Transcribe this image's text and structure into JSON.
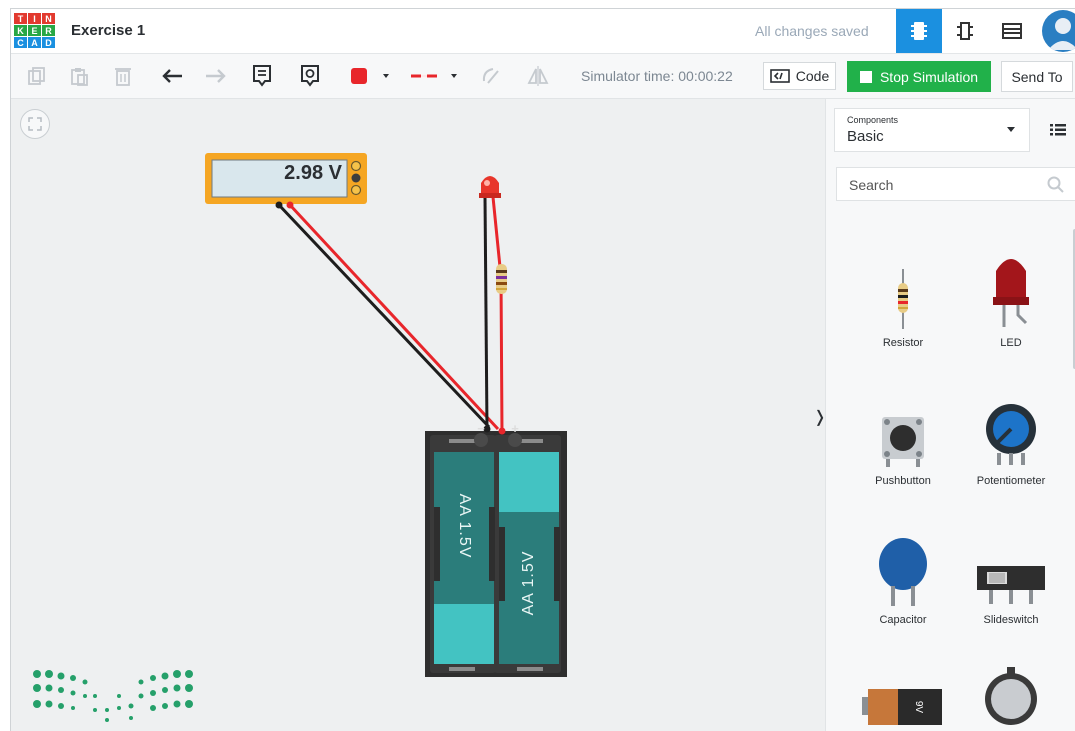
{
  "app": {
    "logo_letters": [
      "T",
      "I",
      "N",
      "K",
      "E",
      "R",
      "C",
      "A",
      "D"
    ],
    "logo_colors": [
      "#e23a2f",
      "#e23a2f",
      "#e23a2f",
      "#28a745",
      "#28a745",
      "#28a745",
      "#1b90e0",
      "#1b90e0",
      "#1b90e0"
    ],
    "project_title": "Exercise 1",
    "save_status": "All changes saved"
  },
  "header": {
    "view_buttons": [
      "circuit-view-icon",
      "schematic-view-icon",
      "component-list-icon"
    ],
    "accent": "#1b90e0"
  },
  "toolbar": {
    "sim_time_label": "Simulator time: 00:00:22",
    "code_label": "Code",
    "stop_label": "Stop Simulation",
    "send_label": "Send To",
    "wire_color": "#e8262b"
  },
  "circuit": {
    "multimeter_reading": "2.98 V",
    "battery_label": "AA 1.5V",
    "battery_neg": "−",
    "battery_pos": "+"
  },
  "panel": {
    "components_small_label": "Components",
    "components_value": "Basic",
    "search_placeholder": "Search",
    "items": [
      {
        "label": "Resistor",
        "icon": "resistor-icon"
      },
      {
        "label": "LED",
        "icon": "led-icon"
      },
      {
        "label": "Pushbutton",
        "icon": "pushbutton-icon"
      },
      {
        "label": "Potentiometer",
        "icon": "potentiometer-icon"
      },
      {
        "label": "Capacitor",
        "icon": "capacitor-icon"
      },
      {
        "label": "Slideswitch",
        "icon": "slideswitch-icon"
      },
      {
        "label": "",
        "icon": "battery-9v-icon"
      },
      {
        "label": "",
        "icon": "coin-cell-battery-icon"
      }
    ]
  },
  "colors": {
    "stop_button": "#21b14a",
    "wire_red": "#e8262b",
    "wire_black": "#1d1d1d",
    "battery_teal": "#2b7d7b",
    "multimeter_orange": "#f5a623"
  }
}
